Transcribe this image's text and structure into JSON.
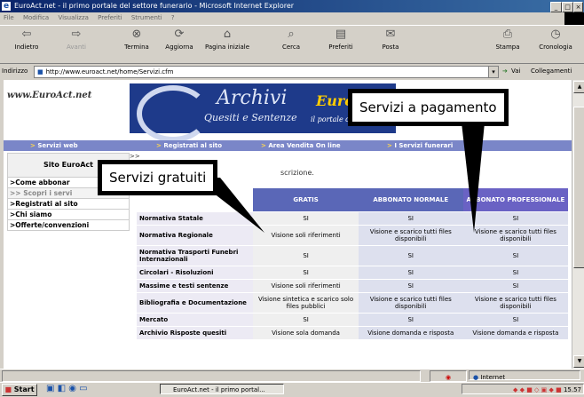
{
  "window": {
    "title": "EuroAct.net - il primo portale del settore funerario - Microsoft Internet Explorer"
  },
  "menu": [
    "File",
    "Modifica",
    "Visualizza",
    "Preferiti",
    "Strumenti",
    "?"
  ],
  "toolbar": {
    "back": "Indietro",
    "forward": "Avanti",
    "stop": "Termina",
    "refresh": "Aggiorna",
    "home": "Pagina iniziale",
    "search": "Cerca",
    "favorites": "Preferiti",
    "mail": "Posta",
    "print": "Stampa",
    "history": "Cronologia"
  },
  "address": {
    "label": "Indirizzo",
    "url": "http://www.euroact.net/home/Servizi.cfm",
    "go": "Vai",
    "links": "Collegamenti"
  },
  "page": {
    "logo": "www.EuroAct.net",
    "banner": {
      "title": "Archivi",
      "subtitle": "Quesiti e Sentenze",
      "brand": "Euro",
      "tagline": "il portale del"
    },
    "nav": [
      "Servizi web",
      "Registrati al sito",
      "Area Vendita On line",
      "I Servizi funerari"
    ],
    "sidebar": {
      "title": "Sito EuroAct",
      "items": [
        "Come abbonar",
        "Scopri i servi",
        "Registrati al sito",
        "Chi siamo",
        "Offerte/convenzioni"
      ]
    },
    "intro": "scrizione.",
    "table": {
      "headers": [
        "",
        "GRATIS",
        "ABBONATO NORMALE",
        "ABBONATO PROFESSIONALE"
      ],
      "rows": [
        [
          "Normativa Statale",
          "SI",
          "SI",
          "SI"
        ],
        [
          "Normativa Regionale",
          "Visione soli riferimenti",
          "Visione e scarico tutti files disponibili",
          "Visione e scarico tutti files disponibili"
        ],
        [
          "Normativa Trasporti Funebri Internazionali",
          "SI",
          "SI",
          "SI"
        ],
        [
          "Circolari - Risoluzioni",
          "SI",
          "SI",
          "SI"
        ],
        [
          "Massime e testi sentenze",
          "Visione soli riferimenti",
          "SI",
          "SI"
        ],
        [
          "Bibliografia e Documentazione",
          "Visione sintetica e scarico solo files pubblici",
          "Visione e scarico tutti files disponibili",
          "Visione e scarico tutti files disponibili"
        ],
        [
          "Mercato",
          "SI",
          "SI",
          "SI"
        ],
        [
          "Archivio Risposte quesiti",
          "Visione sola domanda",
          "Visione domanda e risposta",
          "Visione domanda e risposta"
        ]
      ]
    }
  },
  "callouts": {
    "free": "Servizi gratuiti",
    "paid": "Servizi a pagamento"
  },
  "status": {
    "zone": "Internet"
  },
  "taskbar": {
    "start": "Start",
    "task": "EuroAct.net - il primo portal...",
    "clock": "15.57"
  }
}
